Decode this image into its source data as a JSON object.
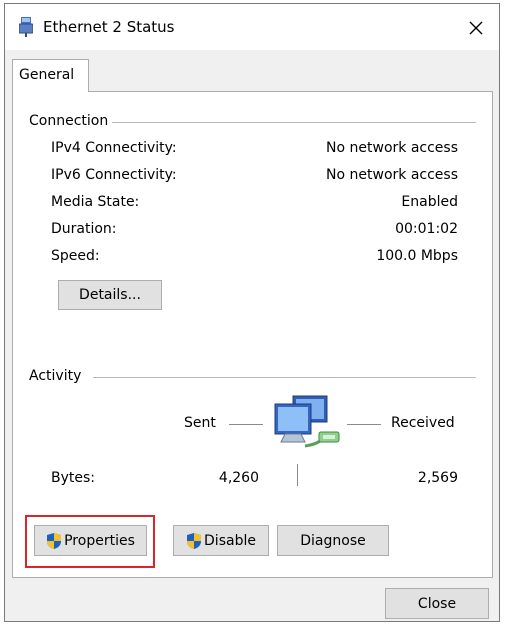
{
  "window": {
    "title": "Ethernet 2 Status",
    "icon": "ethernet-icon"
  },
  "tabs": [
    {
      "label": "General"
    }
  ],
  "connection": {
    "section_label": "Connection",
    "rows": [
      {
        "label": "IPv4 Connectivity:",
        "value": "No network access"
      },
      {
        "label": "IPv6 Connectivity:",
        "value": "No network access"
      },
      {
        "label": "Media State:",
        "value": "Enabled"
      },
      {
        "label": "Duration:",
        "value": "00:01:02"
      },
      {
        "label": "Speed:",
        "value": "100.0 Mbps"
      }
    ],
    "details_button": "Details..."
  },
  "activity": {
    "section_label": "Activity",
    "sent_label": "Sent",
    "received_label": "Received",
    "bytes_label": "Bytes:",
    "bytes_sent": "4,260",
    "bytes_received": "2,569",
    "icon": "network-computers-icon"
  },
  "buttons": {
    "properties": "Properties",
    "disable": "Disable",
    "diagnose": "Diagnose",
    "close": "Close"
  },
  "colors": {
    "highlight": "#d9252b",
    "shield_blue": "#1f5fbf",
    "shield_yellow": "#f2c12e"
  }
}
